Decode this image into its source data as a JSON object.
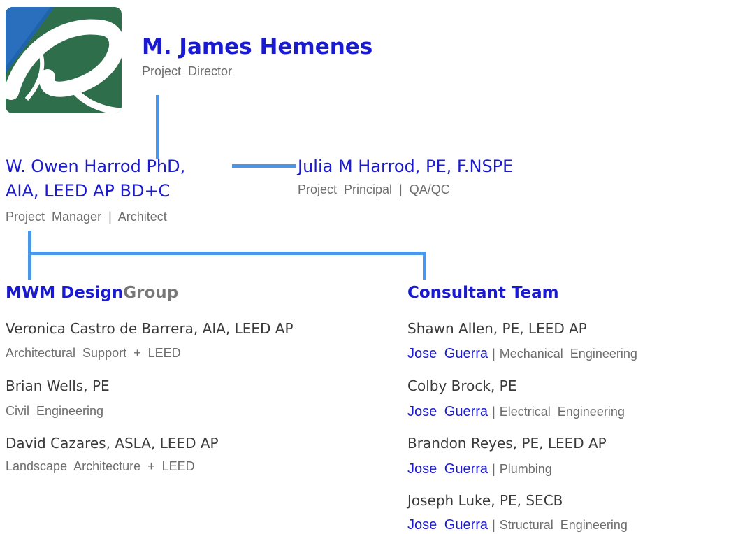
{
  "director": {
    "name": "M. James Hemenes",
    "role": "Project Director"
  },
  "manager": {
    "name_line1": "W. Owen Harrod PhD,",
    "name_line2": "AIA, LEED AP BD+C",
    "role": "Project Manager | Architect"
  },
  "principal": {
    "name": "Julia M Harrod, PE, F.NSPE",
    "role": "Project Principal | QA/QC"
  },
  "mwm_group": {
    "title_part1": "MWM Design",
    "title_part2": "Group",
    "members": [
      {
        "name": "Veronica Castro de Barrera, AIA, LEED AP",
        "role": "Architectural Support + LEED"
      },
      {
        "name": "Brian Wells, PE",
        "role": "Civil Engineering"
      },
      {
        "name": "David Cazares, ASLA, LEED AP",
        "role": "Landscape Architecture + LEED"
      }
    ]
  },
  "consultant_team": {
    "title": "Consultant Team",
    "separator": "|",
    "members": [
      {
        "name": "Shawn Allen, PE, LEED AP",
        "lead": "Jose Guerra",
        "role": "Mechanical Engineering"
      },
      {
        "name": "Colby Brock, PE",
        "lead": "Jose Guerra",
        "role": "Electrical Engineering"
      },
      {
        "name": "Brandon Reyes, PE, LEED AP",
        "lead": "Jose Guerra",
        "role": "Plumbing"
      },
      {
        "name": "Joseph Luke, PE, SECB",
        "lead": "Jose Guerra",
        "role": "Structural Engineering"
      }
    ]
  },
  "colors": {
    "name_blue": "#1a1ad0",
    "connector_blue": "#4a96e8",
    "logo_blue": "#1f63ad",
    "logo_green": "#2e6e4a"
  }
}
